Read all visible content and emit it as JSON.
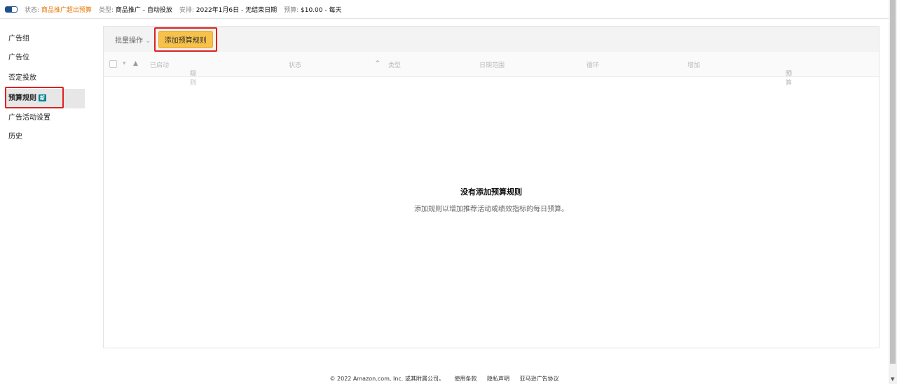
{
  "topbar": {
    "status_label": "状态:",
    "status_value": "商品推广超出预算",
    "type_label": "类型:",
    "type_value": "商品推广 - 自动投放",
    "schedule_label": "安排:",
    "schedule_value": "2022年1月6日 - 无结束日期",
    "budget_label": "预算:",
    "budget_value": "$10.00 - 每天"
  },
  "sidebar": {
    "items": [
      "广告组",
      "广告位",
      "否定投放",
      "预算规则",
      "广告活动设置",
      "历史"
    ],
    "badge": "新"
  },
  "toolbar": {
    "bulk": "批量操作",
    "add": "添加预算规则"
  },
  "columns": {
    "enabled": "已启动",
    "rule": "规则",
    "status": "状态",
    "type": "类型",
    "date_range": "日期范围",
    "recurrence": "循环",
    "increase": "增加",
    "budget": "预算"
  },
  "empty": {
    "title": "没有添加预算规则",
    "desc": "添加规则以增加推荐活动或绩效指标的每日预算。"
  },
  "footer": {
    "copyright": "© 2022 Amazon.com, Inc. 或其附属公司。",
    "terms": "使用条款",
    "privacy": "隐私声明",
    "agreement": "亚马逊广告协议"
  }
}
